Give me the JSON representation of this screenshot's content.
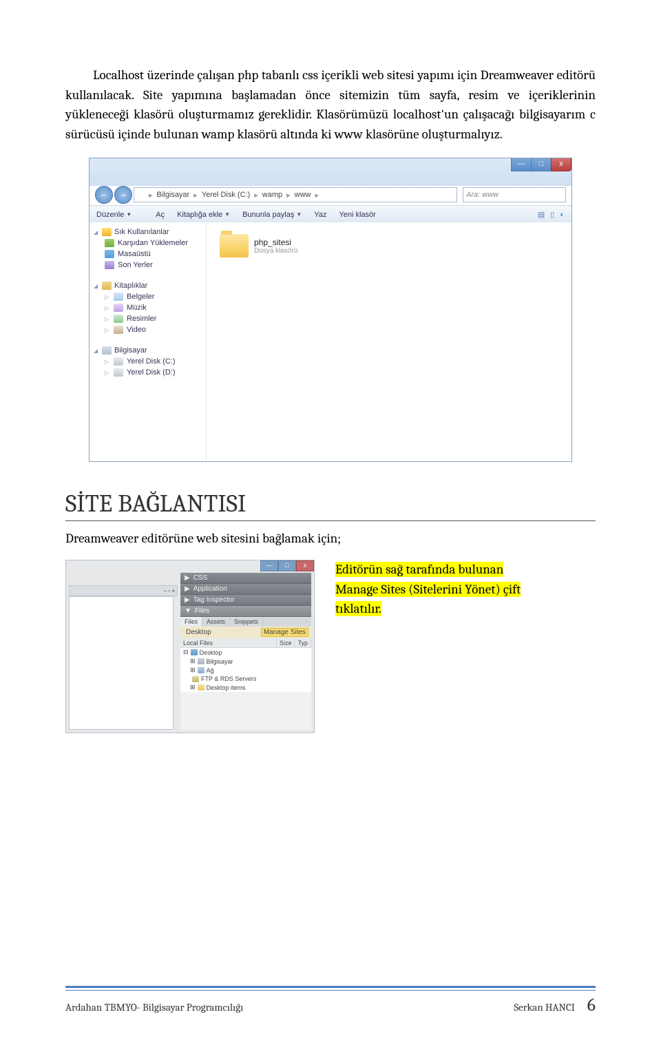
{
  "para1": "Localhost üzerinde çalışan php tabanlı css içerikli web sitesi yapımı için Dreamweaver editörü kullanılacak. Site yapımına başlamadan önce sitemizin tüm sayfa, resim ve içeriklerinin yükleneceği klasörü oluşturmamız gereklidir. Klasörümüzü localhost'un çalışacağı bilgisayarım c sürücüsü içinde bulunan wamp klasörü altında ki www klasörüne oluşturmalıyız.",
  "explorer": {
    "win_min": "—",
    "win_max": "□",
    "win_close": "x",
    "nav_back": "←",
    "nav_fwd": "→",
    "breadcrumb": [
      "Bilgisayar",
      "Yerel Disk (C:)",
      "wamp",
      "www"
    ],
    "bc_sep": "▸",
    "search_prefix": "Ara:",
    "search_term": "www",
    "toolbar": {
      "organize": "Düzenle",
      "open": "Aç",
      "library": "Kitaplığa ekle",
      "share": "Bununla paylaş",
      "burn": "Yaz",
      "newfolder": "Yeni klasör"
    },
    "sidebar": {
      "favorites": "Sık Kullanılanlar",
      "downloads": "Karşıdan Yüklemeler",
      "desktop": "Masaüstü",
      "recent": "Son Yerler",
      "libraries": "Kitaplıklar",
      "documents": "Belgeler",
      "music": "Müzik",
      "pictures": "Resimler",
      "video": "Video",
      "computer": "Bilgisayar",
      "drive_c": "Yerel Disk (C:)",
      "drive_d": "Yerel Disk (D:)"
    },
    "file": {
      "name": "php_sitesi",
      "type": "Dosya klasörü"
    }
  },
  "heading": "SİTE BAĞLANTISI",
  "para2": "Dreamweaver editörüne web sitesini bağlamak için;",
  "dw": {
    "win_min": "—",
    "win_max": "□",
    "win_close": "x",
    "docbar_close": "– ▫ ×",
    "panels": {
      "css": "CSS",
      "app": "Application",
      "tag": "Tag Inspector",
      "files": "Files"
    },
    "files_tabs": {
      "files": "Files",
      "assets": "Assets",
      "snippets": "Snippets"
    },
    "desktop_sel": "Desktop",
    "manage": "Manage Sites",
    "cols": {
      "local": "Local Files",
      "size": "Size",
      "type": "Typ"
    },
    "tree": {
      "desktop": "Desktop",
      "computer": "Bilgisayar",
      "network": "Ağ",
      "ftp": "FTP & RDS Servers",
      "items": "Desktop items"
    }
  },
  "highlight": {
    "l1a": "Editörün sağ tarafında bulunan",
    "l2a": "Manage Sites (Sitelerini Yönet) çift",
    "l3a": "tıklatılır."
  },
  "footer": {
    "left": "Ardahan TBMYO- Bilgisayar Programcılığı",
    "author": "Serkan HANCI",
    "page": "6"
  }
}
